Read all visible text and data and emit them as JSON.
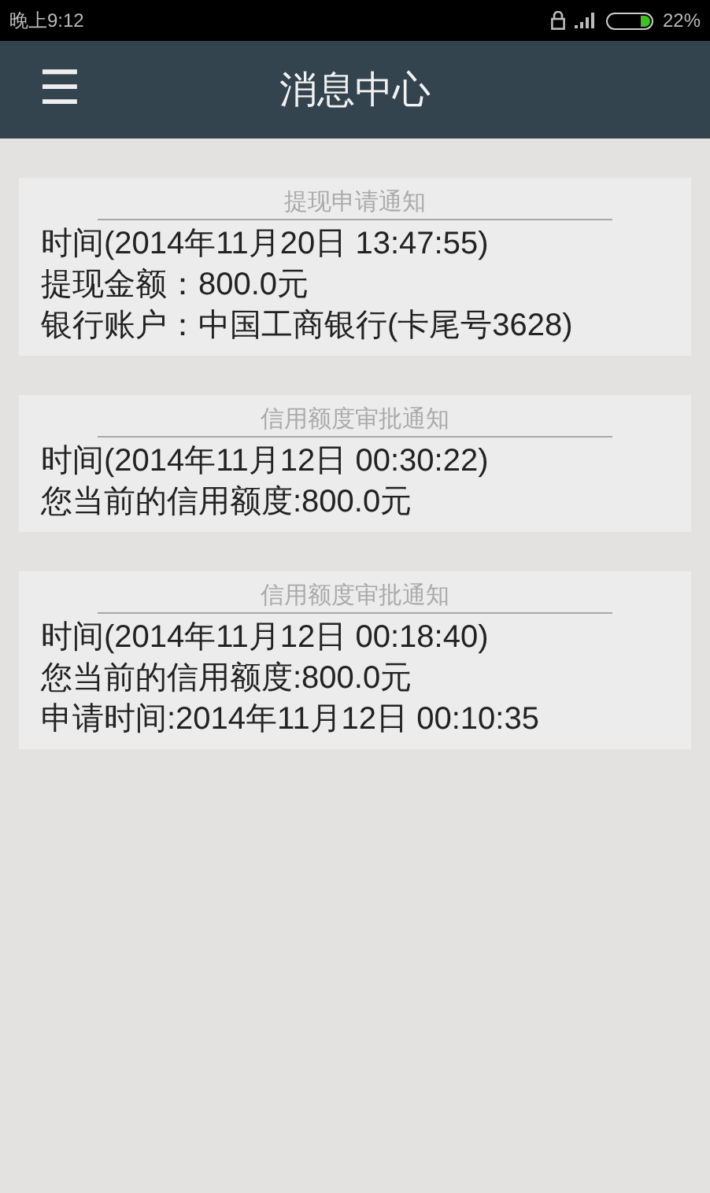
{
  "status_bar": {
    "time": "晚上9:12",
    "battery": {
      "text": "22%",
      "level": 0.22
    }
  },
  "app_bar": {
    "menu_icon": "☰",
    "title": "消息中心"
  },
  "notices": [
    {
      "title": "提现申请通知",
      "lines": [
        "时间(2014年11月20日 13:47:55)",
        "提现金额：800.0元",
        "银行账户：中国工商银行(卡尾号3628)"
      ]
    },
    {
      "title": "信用额度审批通知",
      "lines": [
        "时间(2014年11月12日 00:30:22)",
        "您当前的信用额度:800.0元"
      ]
    },
    {
      "title": "信用额度审批通知",
      "lines": [
        "时间(2014年11月12日 00:18:40)",
        "您当前的信用额度:800.0元",
        "申请时间:2014年11月12日 00:10:35"
      ]
    }
  ]
}
